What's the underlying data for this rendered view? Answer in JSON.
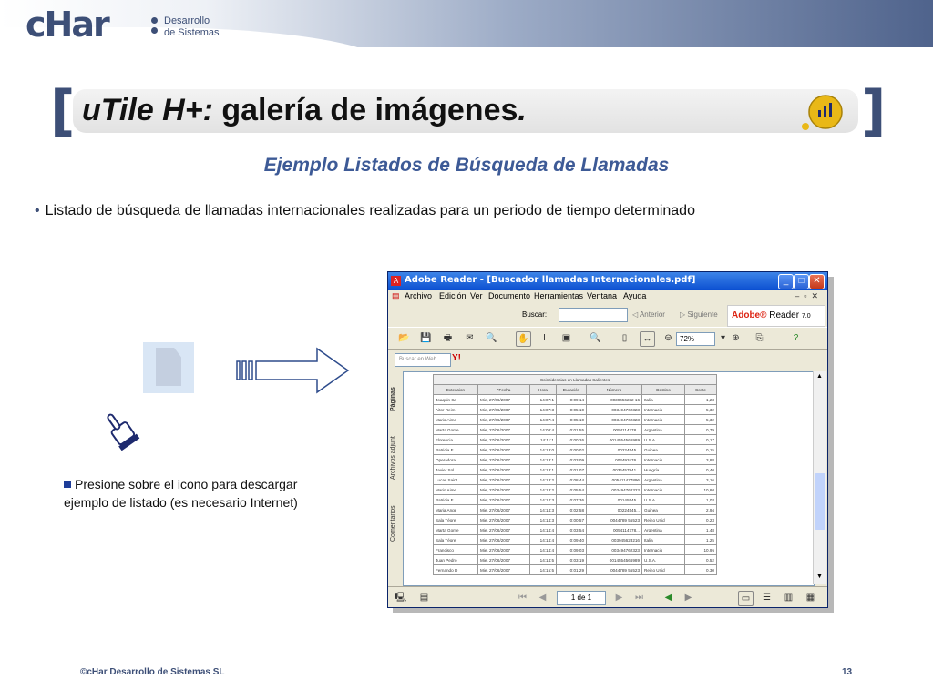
{
  "header": {
    "logo_text": "cHar",
    "logo_sub_line1": "Desarrollo",
    "logo_sub_line2": "de Sistemas"
  },
  "title": {
    "italic": "uTile H+:",
    "rest": " galería de imágenes",
    "dot": "."
  },
  "subtitle": "Ejemplo Listados de Búsqueda de Llamadas",
  "bullet": "Listado de búsqueda de llamadas internacionales realizadas para un periodo de tiempo determinado",
  "note": "Presione sobre el icono para descargar  ejemplo de listado (es necesario Internet)",
  "window": {
    "title": "Adobe Reader - [Buscador llamadas Internacionales.pdf]",
    "menu": [
      "Archivo",
      "Edición",
      "Ver",
      "Documento",
      "Herramientas",
      "Ventana",
      "Ayuda"
    ],
    "search_label": "Buscar:",
    "prev_label": "Anterior",
    "next_label": "Siguiente",
    "brand": "Adobe",
    "brand_product": "Reader",
    "brand_version": "7.0",
    "zoom": "72%",
    "web_search_placeholder": "Buscar en Web",
    "yahoo": "Y!",
    "side_tabs": [
      "Páginas",
      "Archivos adjunt",
      "Comentarios"
    ],
    "page_indicator": "1 de 1"
  },
  "table": {
    "caption": "Coincidencias en Llamadas Salientes",
    "headers": [
      "Extension",
      "*Fecha",
      "Hora",
      "Duración",
      "Número",
      "Destino",
      "Coste"
    ],
    "rows": [
      [
        "Joaquin Sa",
        "Mie, 27/06/2007",
        "14:07:1",
        "0:09:14",
        "0039456232 16",
        "Italia",
        "1,23"
      ],
      [
        "Aitor Reim",
        "Mie, 27/06/2007",
        "14:07:3",
        "0:05:10",
        "003494762323",
        "Internacio",
        "5,32"
      ],
      [
        "Mario Aime",
        "Mie, 27/06/2007",
        "14:07:4",
        "0:05:10",
        "003494762323",
        "Internacio",
        "5,32"
      ],
      [
        "Marta Gome",
        "Mie, 27/06/2007",
        "14:08:4",
        "0:01:55",
        "0054114778...",
        "Argentina",
        "0,79"
      ],
      [
        "Florencia",
        "Mie, 27/06/2007",
        "14:11:1",
        "0:00:26",
        "0014554566989",
        "U.S.A.",
        "0,17"
      ],
      [
        "Patricia F",
        "Mie, 27/06/2007",
        "14:13:0",
        "0:00:02",
        "00224545...",
        "Guinea",
        "0,15"
      ],
      [
        "Operadora",
        "Mie, 27/06/2007",
        "14:13:1",
        "0:03:09",
        "003493476...",
        "Internacio",
        "3,88"
      ],
      [
        "Javier Sol",
        "Mie, 27/06/2007",
        "14:13:1",
        "0:01:07",
        "0036457841...",
        "Hungría",
        "0,40"
      ],
      [
        "Lucas Saint",
        "Mie, 27/06/2007",
        "14:13:2",
        "0:08:44",
        "005411477896",
        "Argentina",
        "3,16"
      ],
      [
        "Mario Aime",
        "Mie, 27/06/2007",
        "14:13:2",
        "0:05:54",
        "003494762323",
        "Internacio",
        "10,80"
      ],
      [
        "Patricia F",
        "Mie, 27/06/2007",
        "14:14:3",
        "0:07:36",
        "00145545...",
        "U.S.A.",
        "1,03"
      ],
      [
        "Maria Ange",
        "Mie, 27/06/2007",
        "14:14:3",
        "0:02:58",
        "00224545...",
        "Guinea",
        "2,94"
      ],
      [
        "Sala Téore",
        "Mie, 27/06/2007",
        "14:14:3",
        "0:00:57",
        "0044789 55523",
        "Reino Unid",
        "0,23"
      ],
      [
        "Marta Gome",
        "Mie, 27/06/2007",
        "14:14:4",
        "0:03:54",
        "0054114778...",
        "Argentina",
        "1,48"
      ],
      [
        "Sala Téore",
        "Mie, 27/06/2007",
        "14:14:4",
        "0:09:40",
        "003945623216",
        "Italia",
        "1,25"
      ],
      [
        "Francisco",
        "Mie, 27/06/2007",
        "14:14:4",
        "0:09:03",
        "003494762323",
        "Internacio",
        "10,95"
      ],
      [
        "Juan Pedro",
        "Mie, 27/06/2007",
        "14:14:5",
        "0:03:19",
        "0014554566989",
        "U.S.A.",
        "0,52"
      ],
      [
        "Fernando D",
        "Mie, 27/06/2007",
        "14:15:5",
        "0:01:29",
        "0044789 55523",
        "Reino Unid",
        "0,30"
      ]
    ]
  },
  "footer": {
    "left": "©cHar Desarrollo de Sistemas SL",
    "right": "13"
  }
}
